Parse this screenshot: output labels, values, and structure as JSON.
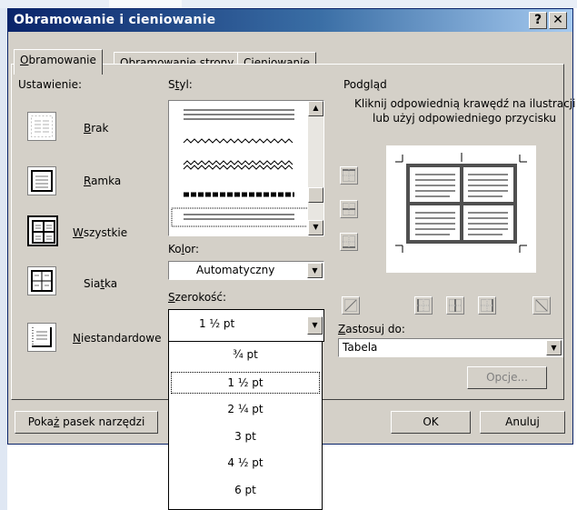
{
  "window": {
    "title": "Obramowanie i cieniowanie",
    "help_label": "?",
    "close_label": "✕"
  },
  "tabs": [
    {
      "pre": "",
      "acc": "O",
      "post": "bramowanie"
    },
    {
      "pre": "Obra",
      "acc": "m",
      "post": "owanie strony"
    },
    {
      "pre": "Ci",
      "acc": "e",
      "post": "niowanie"
    }
  ],
  "setting": {
    "label": "Ustawienie:",
    "options": [
      {
        "acc": "B",
        "rest": "rak",
        "pre": ""
      },
      {
        "acc": "R",
        "rest": "amka",
        "pre": ""
      },
      {
        "acc": "W",
        "rest": "szystkie",
        "pre": ""
      },
      {
        "pre": "Sia",
        "acc": "t",
        "rest": "ka"
      },
      {
        "acc": "N",
        "rest": "iestandardowe",
        "pre": ""
      }
    ]
  },
  "style": {
    "label_pre": "S",
    "label_acc": "t",
    "label_post": "yl:"
  },
  "color": {
    "label_pre": "Ko",
    "label_acc": "l",
    "label_post": "or:",
    "value": "Automatyczny"
  },
  "width": {
    "label_pre": "",
    "label_acc": "S",
    "label_post": "zerokość:",
    "value": "1 ½ pt",
    "options": [
      "¾ pt",
      "1 ½ pt",
      "2 ¼ pt",
      "3 pt",
      "4 ½ pt",
      "6 pt"
    ],
    "selected_index": 1
  },
  "preview": {
    "label": "Podgląd",
    "hint_line1": "Kliknij odpowiednią krawędź na ilustracji",
    "hint_line2": "lub użyj odpowiedniego przycisku"
  },
  "apply": {
    "label_pre": "",
    "label_acc": "Z",
    "label_post": "astosuj do:",
    "value": "Tabela"
  },
  "buttons": {
    "options_label": "Opcje...",
    "toolbar_pre": "Poka",
    "toolbar_acc": "ż",
    "toolbar_post": " pasek narzędzi",
    "ok_label": "OK",
    "cancel_label": "Anuluj"
  },
  "colors": {
    "title_start": "#0a246a",
    "title_end": "#a6caf0",
    "face": "#d4d0c8"
  }
}
